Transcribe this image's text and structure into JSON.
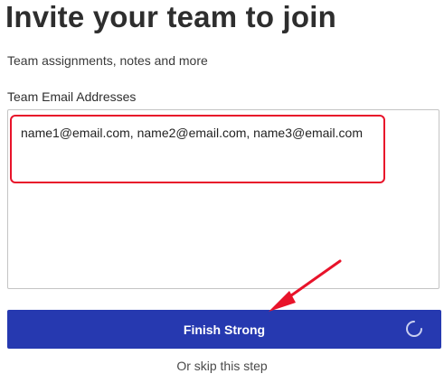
{
  "header": {
    "title": "Invite your team to join",
    "subtitle": "Team assignments, notes and more"
  },
  "form": {
    "email_label": "Team Email Addresses",
    "email_value": "name1@email.com, name2@email.com, name3@email.com"
  },
  "actions": {
    "finish_label": "Finish Strong",
    "skip_label": "Or skip this step"
  },
  "colors": {
    "primary_button": "#2639b0",
    "annotation_red": "#e8132a"
  },
  "icons": {
    "spinner": "loading-spinner-icon",
    "annotation_arrow": "red-arrow-icon"
  }
}
